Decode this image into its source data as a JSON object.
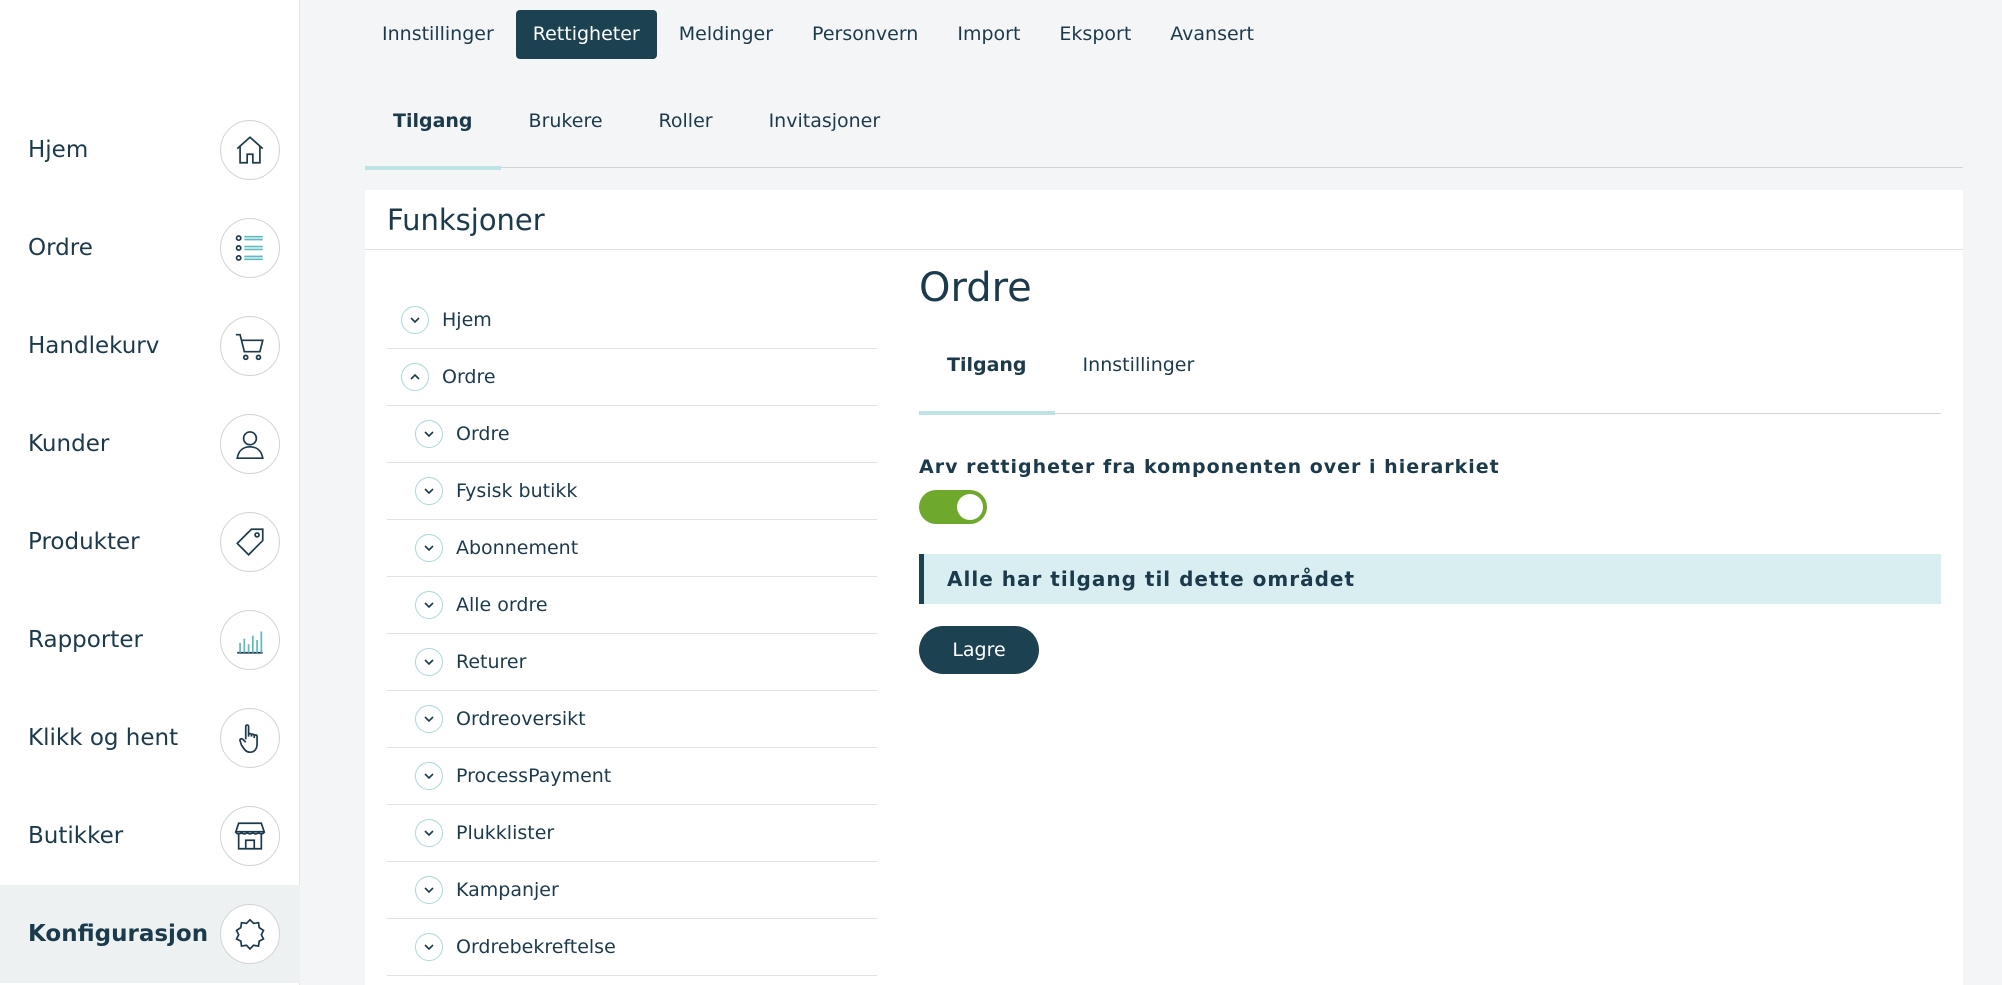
{
  "sidebar": {
    "items": [
      {
        "label": "Hjem",
        "icon": "home-icon"
      },
      {
        "label": "Ordre",
        "icon": "list-icon"
      },
      {
        "label": "Handlekurv",
        "icon": "cart-icon"
      },
      {
        "label": "Kunder",
        "icon": "user-icon"
      },
      {
        "label": "Produkter",
        "icon": "tag-icon"
      },
      {
        "label": "Rapporter",
        "icon": "bar-chart-icon"
      },
      {
        "label": "Klikk og hent",
        "icon": "hand-pointer-icon"
      },
      {
        "label": "Butikker",
        "icon": "store-icon"
      },
      {
        "label": "Konfigurasjon",
        "icon": "gear-icon",
        "active": true
      }
    ]
  },
  "top_tabs": [
    "Innstillinger",
    "Rettigheter",
    "Meldinger",
    "Personvern",
    "Import",
    "Eksport",
    "Avansert"
  ],
  "top_tabs_active": "Rettigheter",
  "sub_tabs": [
    "Tilgang",
    "Brukere",
    "Roller",
    "Invitasjoner"
  ],
  "sub_tabs_active": "Tilgang",
  "card": {
    "title": "Funksjoner"
  },
  "tree": [
    {
      "label": "Hjem",
      "level": 1,
      "expanded": false
    },
    {
      "label": "Ordre",
      "level": 1,
      "expanded": true
    },
    {
      "label": "Ordre",
      "level": 2,
      "expanded": false
    },
    {
      "label": "Fysisk butikk",
      "level": 2,
      "expanded": false
    },
    {
      "label": "Abonnement",
      "level": 2,
      "expanded": false
    },
    {
      "label": "Alle ordre",
      "level": 2,
      "expanded": false
    },
    {
      "label": "Returer",
      "level": 2,
      "expanded": false
    },
    {
      "label": "Ordreoversikt",
      "level": 2,
      "expanded": false
    },
    {
      "label": "ProcessPayment",
      "level": 2,
      "expanded": false
    },
    {
      "label": "Plukklister",
      "level": 2,
      "expanded": false
    },
    {
      "label": "Kampanjer",
      "level": 2,
      "expanded": false
    },
    {
      "label": "Ordrebekreftelse",
      "level": 2,
      "expanded": false
    }
  ],
  "detail": {
    "title": "Ordre",
    "tabs": [
      "Tilgang",
      "Innstillinger"
    ],
    "active_tab": "Tilgang",
    "inherit_label": "Arv rettigheter fra komponenten over i hierarkiet",
    "inherit_enabled": true,
    "notice": "Alle har tilgang til dette området",
    "save_label": "Lagre"
  },
  "colors": {
    "accent": "#1c4251",
    "toggle_on": "#6ea82d",
    "notice_bg": "#d9eef0",
    "tab_underline": "#bde3e6"
  }
}
